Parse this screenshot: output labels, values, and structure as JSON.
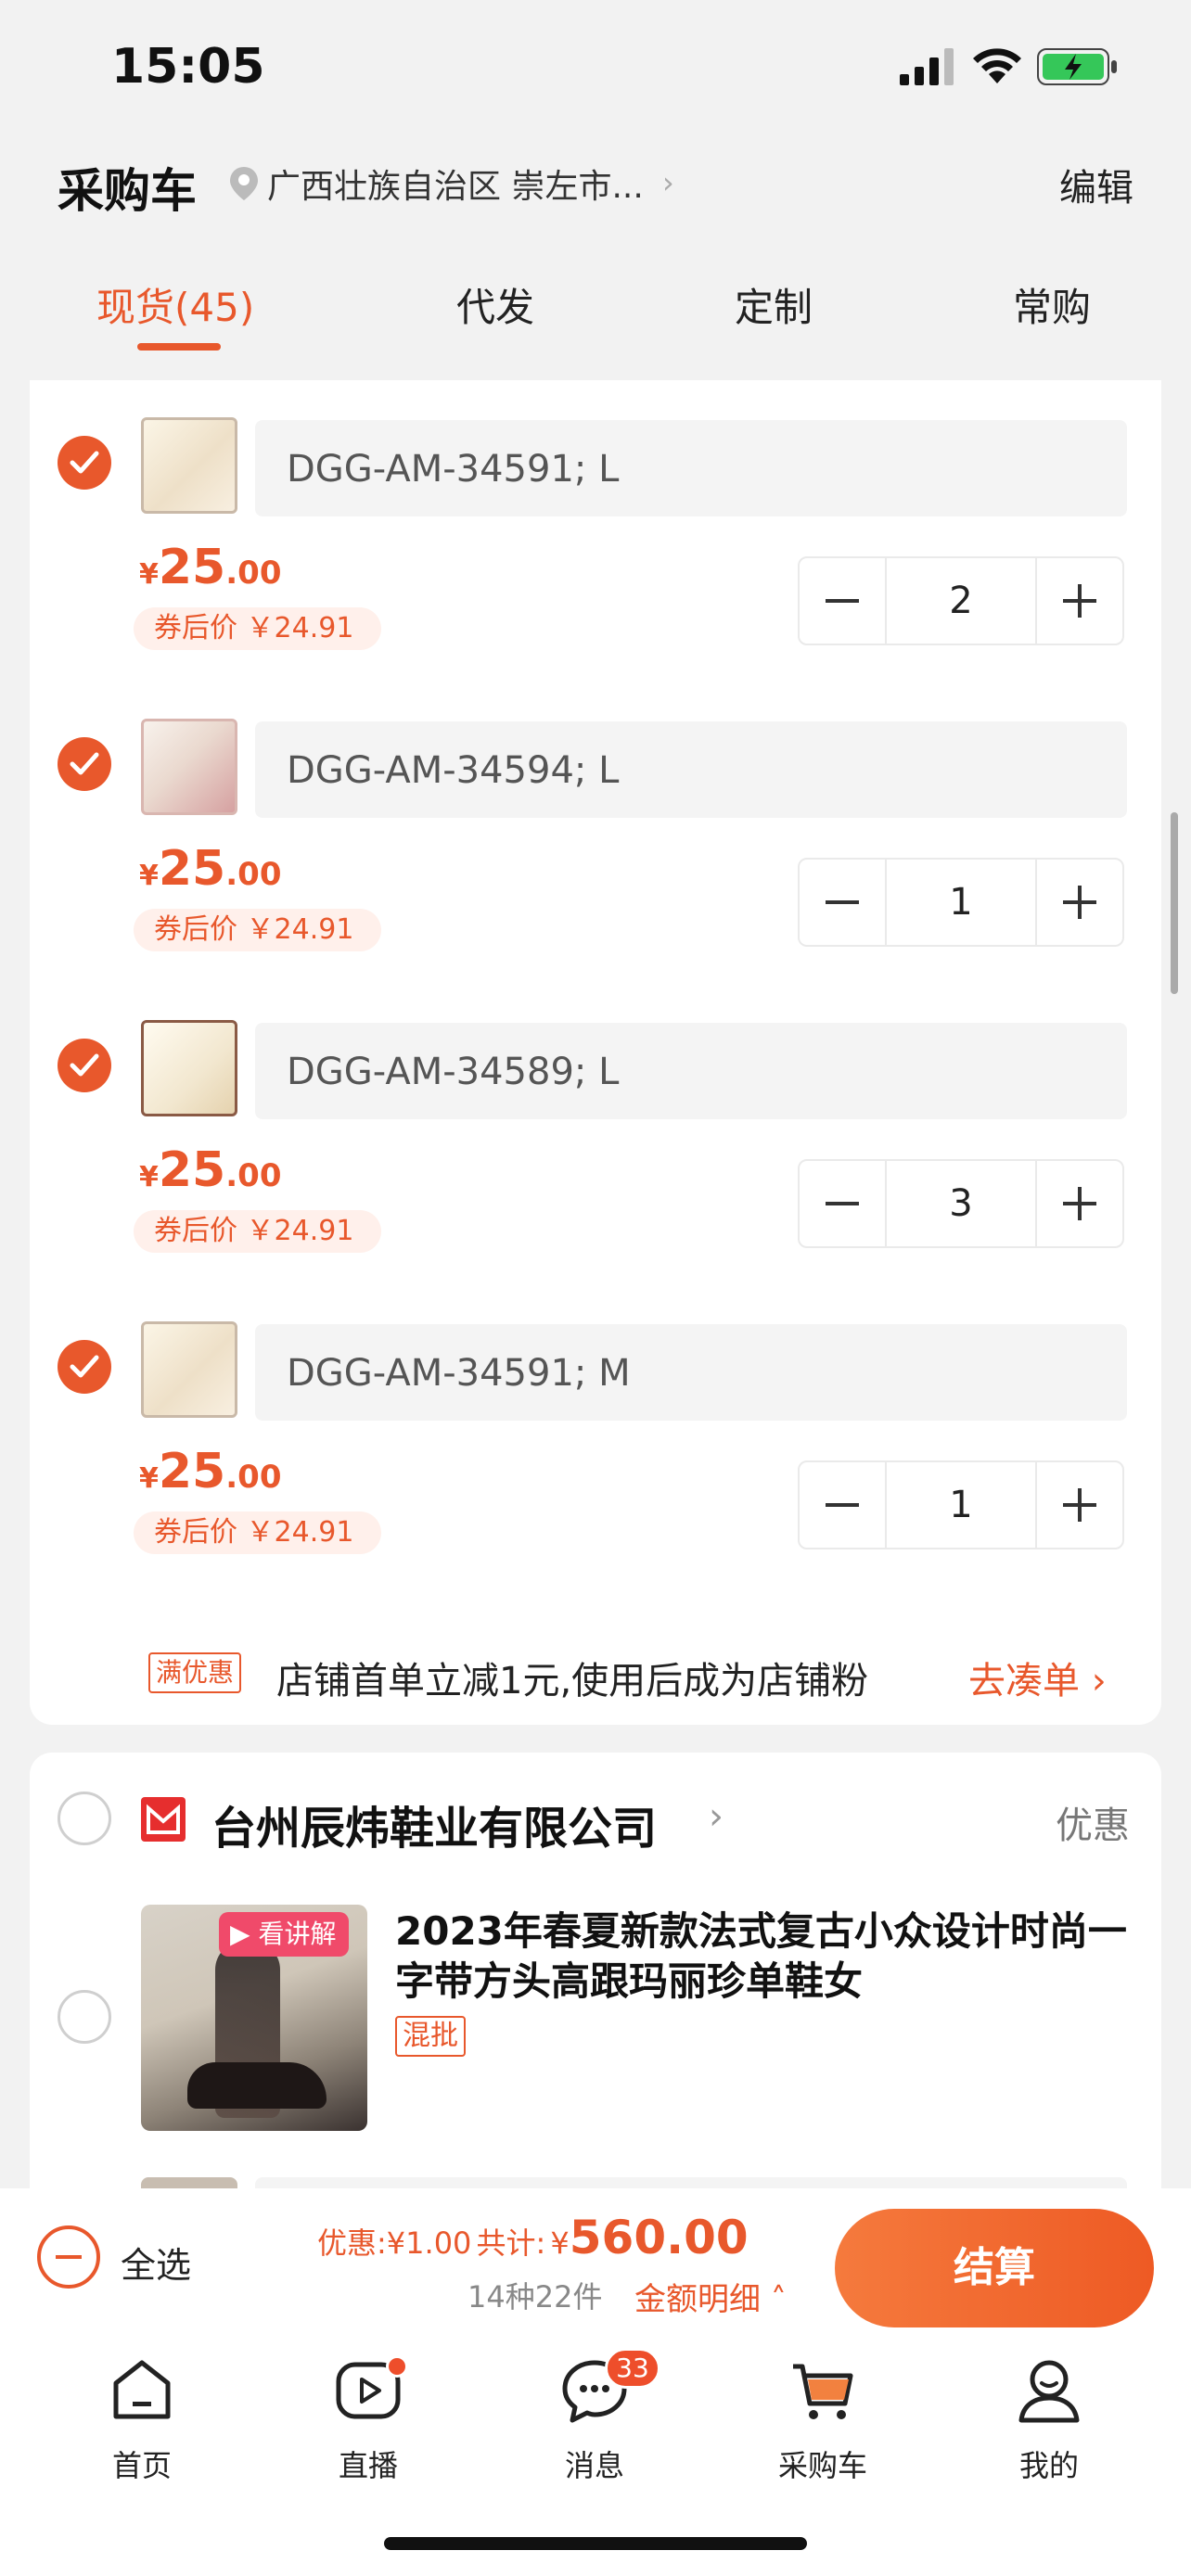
{
  "status_bar": {
    "time": "15:05"
  },
  "header": {
    "title": "采购车",
    "address": "广西壮族自治区 崇左市...",
    "edit_label": "编辑"
  },
  "tabs": [
    {
      "label": "现货(45)",
      "active": true
    },
    {
      "label": "代发",
      "active": false
    },
    {
      "label": "定制",
      "active": false
    },
    {
      "label": "常购",
      "active": false
    }
  ],
  "cart_items": [
    {
      "sku": "DGG-AM-34591; L",
      "price_currency": "¥",
      "price_int": "25",
      "price_dec": ".00",
      "coupon_price": "券后价 ￥24.91",
      "quantity": "2",
      "checked": true
    },
    {
      "sku": "DGG-AM-34594; L",
      "price_currency": "¥",
      "price_int": "25",
      "price_dec": ".00",
      "coupon_price": "券后价 ￥24.91",
      "quantity": "1",
      "checked": true
    },
    {
      "sku": "DGG-AM-34589; L",
      "price_currency": "¥",
      "price_int": "25",
      "price_dec": ".00",
      "coupon_price": "券后价 ￥24.91",
      "quantity": "3",
      "checked": true
    },
    {
      "sku": "DGG-AM-34591; M",
      "price_currency": "¥",
      "price_int": "25",
      "price_dec": ".00",
      "coupon_price": "券后价 ￥24.91",
      "quantity": "1",
      "checked": true
    }
  ],
  "promo": {
    "tag": "满优惠",
    "text": "店铺首单立减1元,使用后成为店铺粉",
    "link": "去凑单"
  },
  "shop": {
    "name": "台州辰炜鞋业有限公司",
    "discount_label": "优惠",
    "product": {
      "video_badge": "看讲解",
      "title": "2023年春夏新款法式复古小众设计时尚一字带方头高跟玛丽珍单鞋女",
      "tag": "混批"
    }
  },
  "checkout": {
    "select_all_label": "全选",
    "discount_label": "优惠:",
    "discount_value": "¥1.00",
    "total_label": "共计:",
    "total_currency": "¥",
    "total_value": "560.00",
    "count_text": "14种22件",
    "detail_link": "金额明细",
    "button_label": "结算"
  },
  "tabbar": [
    {
      "label": "首页",
      "icon": "home-icon"
    },
    {
      "label": "直播",
      "icon": "live-icon"
    },
    {
      "label": "消息",
      "icon": "message-icon",
      "badge": "33"
    },
    {
      "label": "采购车",
      "icon": "cart-icon"
    },
    {
      "label": "我的",
      "icon": "profile-icon"
    }
  ],
  "colors": {
    "accent": "#e8582c",
    "background": "#f2f2f2"
  }
}
